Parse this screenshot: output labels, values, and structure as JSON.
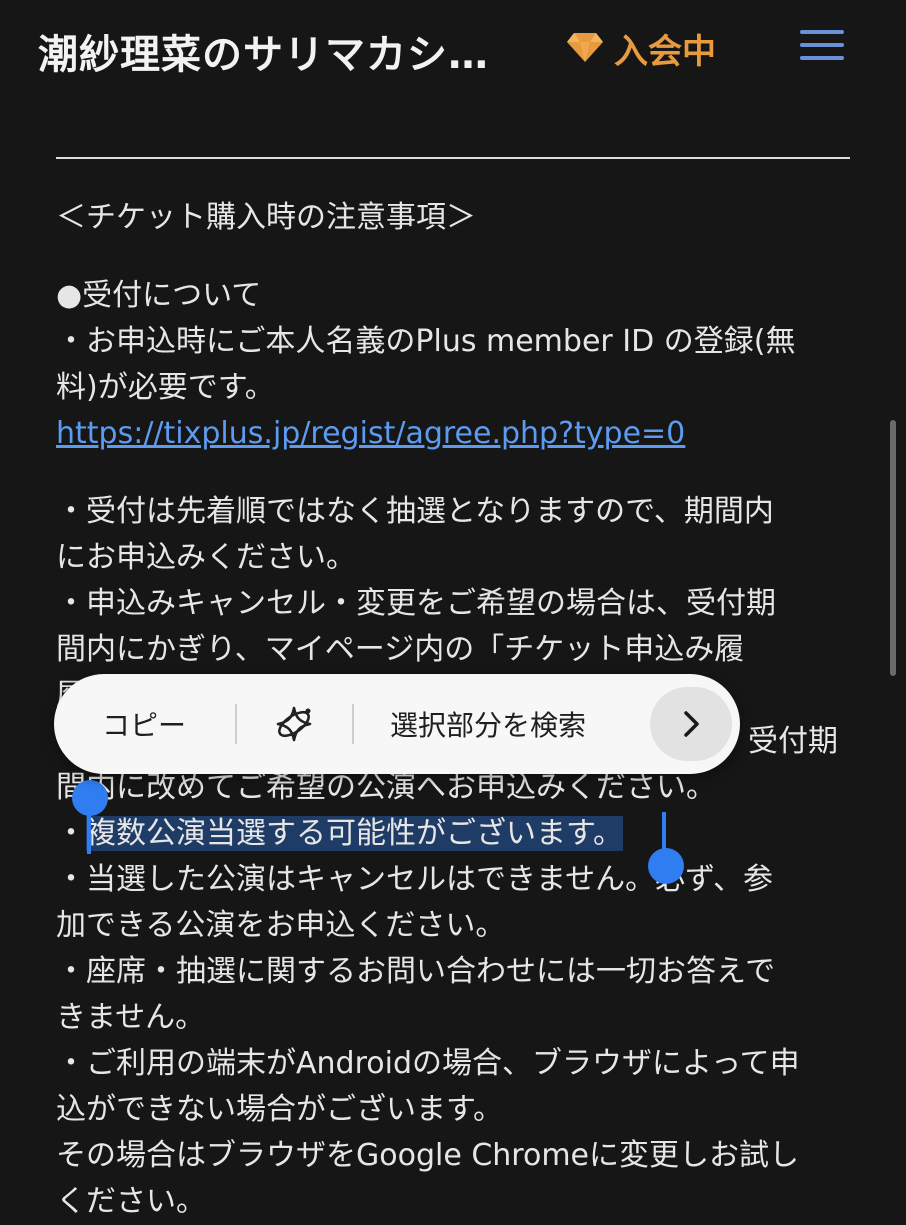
{
  "header": {
    "site_title": "潮紗理菜のサリマカシ…",
    "member_status": "入会中",
    "colors": {
      "accent_orange": "#e89b3e",
      "menu_blue": "#6a90d8"
    }
  },
  "content": {
    "heading": "＜チケット購入時の注意事項＞",
    "section_title": "●受付について",
    "line_1": "・お申込時にご本人名義のPlus member ID の登録(無",
    "line_2": "料)が必要です。",
    "link": "https://tixplus.jp/regist/agree.php?type=0",
    "line_3": "・受付は先着順ではなく抽選となりますので、期間内",
    "line_4": "にお申込みください。",
    "line_5": "・申込みキャンセル・変更をご希望の場合は、受付期",
    "line_6": "間内にかぎり、マイページ内の「チケット申込み履",
    "line_7_hidden": "履",
    "line_8_end": "受付期",
    "line_9": "間内に改めてご希望の公演へお申込みください。",
    "line_10_bullet": "・",
    "line_10_selected": "複数公演当選する可能性がございます。",
    "line_11": "・当選した公演はキャンセルはできません。必ず、参",
    "line_12": "加できる公演をお申込ください。",
    "line_13": "・座席・抽選に関するお問い合わせには一切お答えで",
    "line_14": "きません。",
    "line_15": "・ご利用の端末がAndroidの場合、ブラウザによって申",
    "line_16": "込ができない場合がございます。",
    "line_17": "その場合はブラウザをGoogle Chromeに変更しお試し",
    "line_18": "ください。"
  },
  "context_menu": {
    "copy_label": "コピー",
    "ai_icon": "sparkle-ai-icon",
    "search_label": "選択部分を検索",
    "next_icon": "chevron-right-icon"
  },
  "selection_color": "#1f3c66",
  "handle_color": "#2f7df0"
}
